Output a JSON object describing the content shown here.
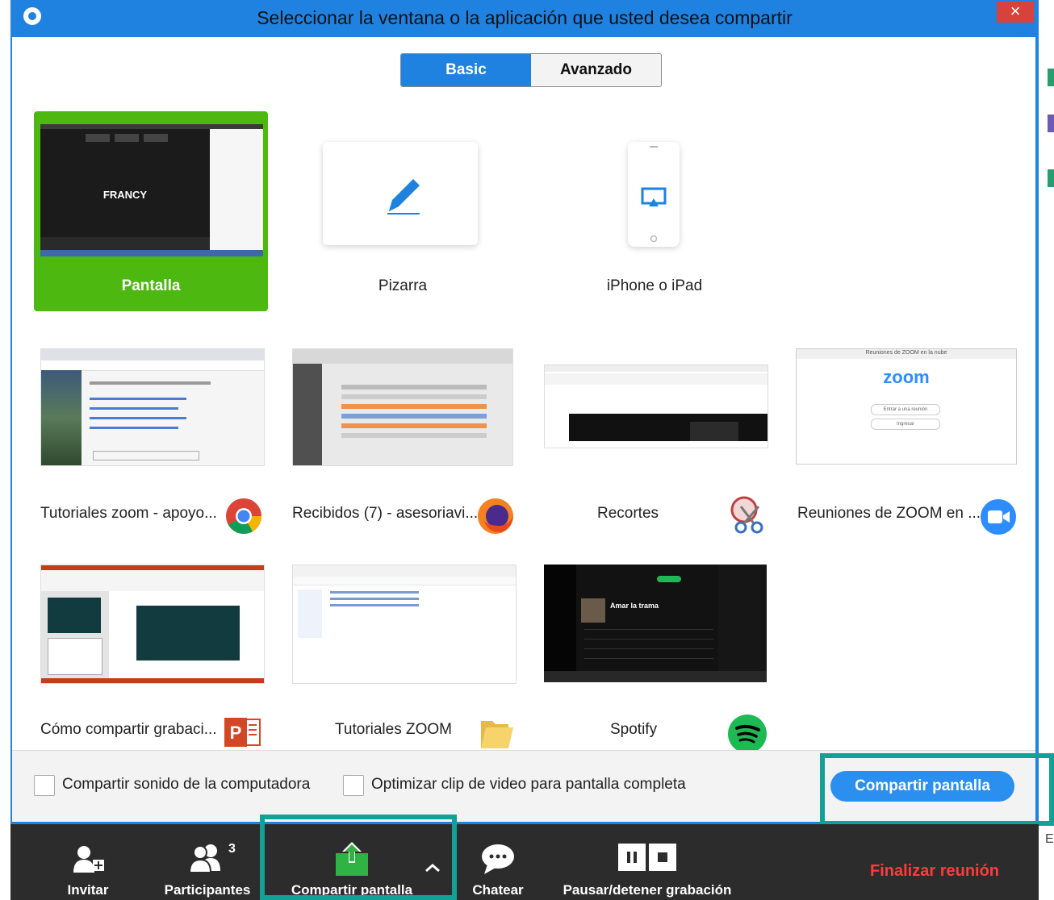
{
  "window": {
    "title": "Seleccionar la ventana o la aplicación que usted desea compartir",
    "close_label": "×"
  },
  "tabs": {
    "basic": "Basic",
    "advanced": "Avanzado"
  },
  "tiles": {
    "screen": {
      "label": "Pantalla",
      "preview_name": "FRANCY"
    },
    "whiteboard": {
      "label": "Pizarra"
    },
    "iphone": {
      "label": "iPhone o iPad"
    },
    "app1": {
      "label": "Tutoriales zoom - apoyo...",
      "icon": "chrome-icon"
    },
    "app2": {
      "label": "Recibidos (7) - asesoriavi...",
      "icon": "firefox-icon"
    },
    "app3": {
      "label": "Recortes",
      "icon": "snipping-tool-icon"
    },
    "app4": {
      "label": "Reuniones de ZOOM en ...",
      "icon": "zoom-icon",
      "preview_title": "Reuniones de ZOOM en la nube",
      "preview_logo": "zoom",
      "preview_btn1": "Entrar a una reunión",
      "preview_btn2": "Ingresar"
    },
    "app5": {
      "label": "Cómo compartir grabaci...",
      "icon": "powerpoint-icon"
    },
    "app6": {
      "label": "Tutoriales ZOOM",
      "icon": "folder-icon"
    },
    "app7": {
      "label": "Spotify",
      "icon": "spotify-icon",
      "preview_title": "Amar la trama"
    }
  },
  "options": {
    "share_sound": "Compartir sonido de la computadora",
    "optimize_video": "Optimizar clip de video para pantalla completa"
  },
  "share_button": "Compartir pantalla",
  "toolbar": {
    "invite": "Invitar",
    "participants": "Participantes",
    "participants_count": "3",
    "share_screen": "Compartir pantalla",
    "chat": "Chatear",
    "record": "Pausar/detener grabación",
    "end": "Finalizar reunión"
  },
  "side_letter": "E",
  "colors": {
    "accent": "#1f82e0",
    "selected": "#4cb810",
    "highlight": "#12a197",
    "end": "#ff3b3b"
  }
}
